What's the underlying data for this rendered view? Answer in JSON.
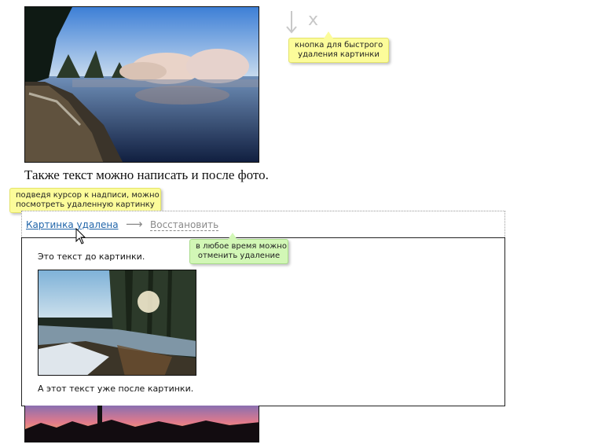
{
  "close_glyph": "x",
  "tips": {
    "delete": [
      "кнопка для быстрого",
      "удаления картинки"
    ],
    "hover": [
      "подведя курсор к надписи, можно",
      "посмотреть удаленную картинку"
    ],
    "restore": [
      "в любое время можно",
      "отменить удаление"
    ]
  },
  "after_photo_text": "Также текст можно написать и после фото.",
  "deleted_bar": {
    "deleted_label": "Картинка удалена",
    "arrow": "⟶",
    "restore_label": "Восстановить"
  },
  "preview": {
    "text_before": "Это текст до картинки.",
    "text_after": "А этот текст уже после картинки."
  },
  "colors": {
    "link": "#2266aa",
    "tip_yellow": "#fcfc9a",
    "tip_green": "#d2f7b6"
  }
}
